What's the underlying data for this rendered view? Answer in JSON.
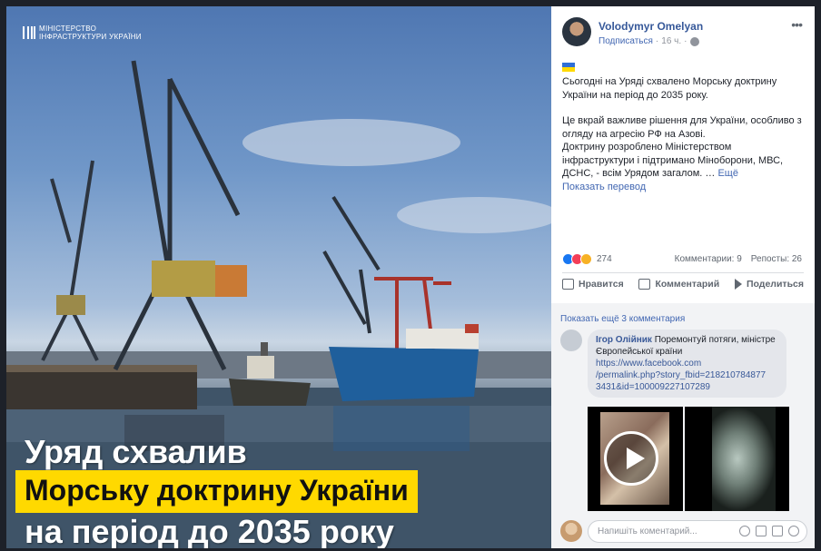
{
  "photo": {
    "ministry_line1": "МІНІСТЕРСТВО",
    "ministry_line2": "ІНФРАСТРУКТУРИ УКРАЇНИ",
    "headline1": "Уряд схвалив",
    "headline2": "Морську доктрину України",
    "headline3": "на період до 2035 року"
  },
  "post": {
    "author": "Volodymyr Omelyan",
    "subscribe": "Подписаться",
    "time": "16 ч.",
    "options": "•••",
    "p1": "Сьогодні на Уряді схвалено Морську доктрину України на період до 2035 року.",
    "p2": "Це вкрай важливе рішення для України, особливо з огляду на агресію РФ на Азові.",
    "p3": "Доктрину розроблено Міністерством інфраструктури і підтримано Міноборони, МВС, ДСНС, - всім Урядом загалом. …",
    "more": "Ещё",
    "translate": "Показать перевод"
  },
  "stats": {
    "reactions_count": "274",
    "comments": "Комментарии: 9",
    "reposts": "Репосты: 26"
  },
  "actions": {
    "like": "Нравится",
    "comment": "Комментарий",
    "share": "Поделиться"
  },
  "comments": {
    "show_more": "Показать ещё 3 комментария",
    "items": [
      {
        "name": "Ігор Олійник",
        "text": "Поремонтуй потяги, міністре Європейської країни",
        "link1": "https://www.facebook.com",
        "link2": "/permalink.php?story_fbid=218210784877",
        "link3": "3431&id=100009227107289"
      }
    ],
    "placeholder": "Напишіть коментарий..."
  },
  "colors": {
    "link": "#365899",
    "headline_highlight": "#ffd900"
  }
}
